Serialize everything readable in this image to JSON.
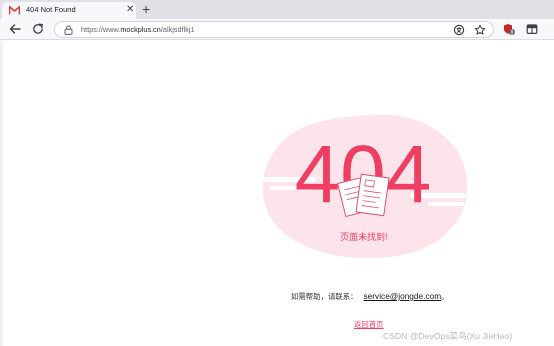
{
  "browser": {
    "tab": {
      "title": "404 Not Found",
      "close_glyph": "✕",
      "favicon": "mockplus-m-icon"
    },
    "new_tab_glyph": "+",
    "nav": {
      "back": "back-arrow-icon",
      "reload": "reload-icon"
    },
    "address": {
      "prefix": "https://www.",
      "host": "mockplus.cn",
      "path": "/alkjsdflkj1"
    },
    "omnibox_icons": [
      "translate-icon",
      "star-icon"
    ],
    "extension_icons": [
      "extension-shield-icon",
      "sidebar-icon"
    ]
  },
  "page": {
    "code": "404",
    "message": "页面未找到!",
    "help_text": "如需帮助，请联系：",
    "email": "service@jongde.com",
    "email_suffix": "。",
    "home_link": "返回首页",
    "watermark": "CSDN @DevOps菜鸟(Xu JieHao)",
    "accent_color": "#ef3e62",
    "blob_color": "#fde4ea"
  }
}
